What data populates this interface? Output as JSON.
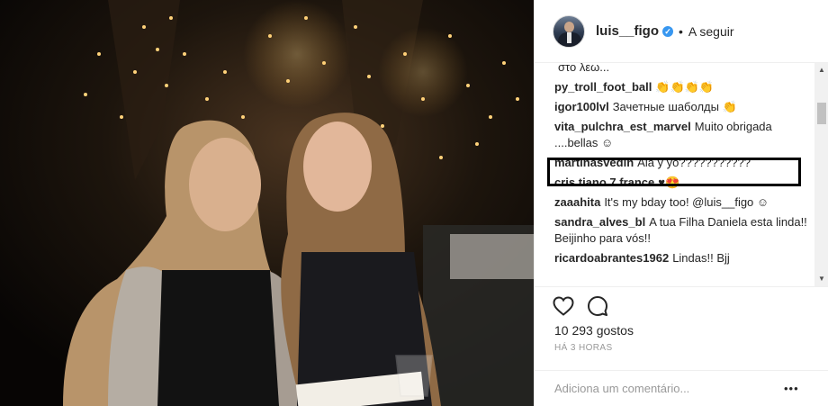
{
  "post": {
    "photo_alt": "",
    "username": "luis__figo",
    "verified_mark": "✓",
    "separator": "•",
    "follow_label": "A seguir"
  },
  "comments": [
    {
      "user": "",
      "text": "στο λεω..."
    },
    {
      "user": "py_troll_foot_ball",
      "text": "👏👏👏👏"
    },
    {
      "user": "igor100lvl",
      "text": "Зачетные шаболды 👏"
    },
    {
      "user": "vita_pulchra_est_marvel",
      "text": "Muito obrigada ....bellas ☺"
    },
    {
      "user": "martinasvedin",
      "text": "Ala y yo???????????"
    },
    {
      "user": "cris.tiano.7.france",
      "text": "♥😍"
    },
    {
      "user": "zaaahita",
      "text": "It's my bday too! @luis__figo ☺"
    },
    {
      "user": "sandra_alves_bl",
      "text": "A tua Filha Daniela esta linda!! Beijinho para vós!!"
    },
    {
      "user": "ricardoabrantes1962",
      "text": "Lindas!! Bjj"
    }
  ],
  "scrollbar": {
    "up": "▲",
    "down": "▼"
  },
  "actions": {
    "like_icon": "heart-icon",
    "comment_icon": "speech-bubble-icon",
    "likes_text": "10 293 gostos",
    "time_text": "HÁ 3 HORAS"
  },
  "add_comment": {
    "placeholder": "Adiciona um comentário...",
    "more_label": "•••"
  },
  "colors": {
    "verified": "#3897f0",
    "muted_text": "#999999",
    "border": "#efefef"
  }
}
